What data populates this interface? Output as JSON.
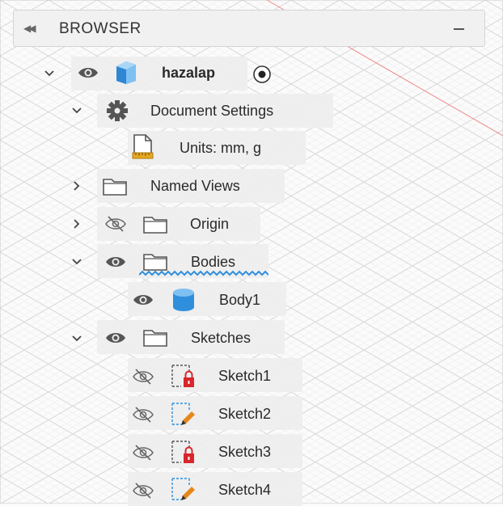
{
  "browser": {
    "title": "BROWSER",
    "icons": {
      "collapse": "double-chevron-left-icon",
      "minimize": "minus-icon"
    },
    "tree": [
      {
        "label": "hazalap",
        "bold": true,
        "expanded": true,
        "visible": true,
        "icon": "component-box-icon",
        "active": true
      },
      {
        "label": "Document Settings",
        "expanded": true,
        "icon": "gear-icon"
      },
      {
        "label": "Units: mm, g",
        "icon": "document-units-icon"
      },
      {
        "label": "Named Views",
        "expanded": false,
        "icon": "folder-icon"
      },
      {
        "label": "Origin",
        "expanded": false,
        "visible": false,
        "icon": "folder-icon"
      },
      {
        "label": "Bodies",
        "expanded": true,
        "visible": true,
        "icon": "folder-icon"
      },
      {
        "label": "Body1",
        "visible": true,
        "icon": "body-cylinder-icon"
      },
      {
        "label": "Sketches",
        "expanded": true,
        "visible": true,
        "icon": "folder-icon"
      },
      {
        "label": "Sketch1",
        "visible": false,
        "icon": "sketch-locked-icon"
      },
      {
        "label": "Sketch2",
        "visible": false,
        "icon": "sketch-edit-icon"
      },
      {
        "label": "Sketch3",
        "visible": false,
        "icon": "sketch-locked-icon"
      },
      {
        "label": "Sketch4",
        "visible": false,
        "icon": "sketch-edit-icon"
      }
    ]
  },
  "colors": {
    "accent_blue": "#2f8fdc",
    "sketch_lock_red": "#d8262c",
    "sketch_edit_orange": "#e6871c",
    "eye_gray": "#555555"
  }
}
